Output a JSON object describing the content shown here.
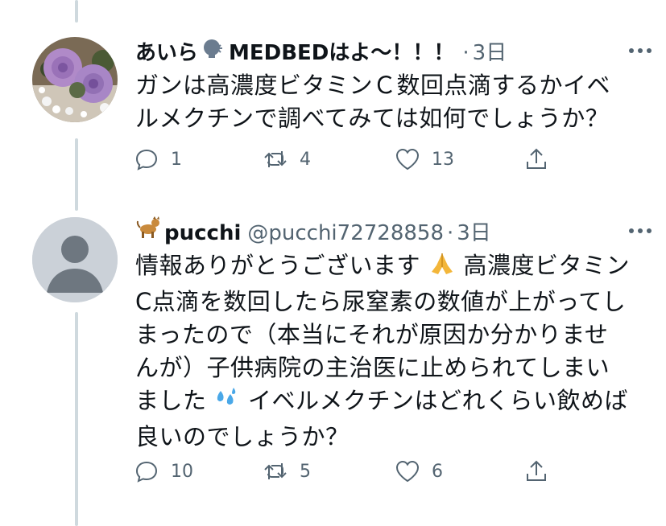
{
  "tweets": [
    {
      "name": "あいら",
      "name_suffix": "MEDBEDはよ〜！！！",
      "handle": "",
      "time": "3日",
      "text_lines": [
        "ガンは高濃度ビタミンＣ数回点滴するかイベ",
        "ルメクチンで調べてみては如何でしょうか？"
      ],
      "replies": "1",
      "retweets": "4",
      "likes": "13",
      "name_icon": "speaking-head-icon"
    },
    {
      "name": "pucchi",
      "handle": "@pucchi72728858",
      "time": "3日",
      "name_icon": "dog-icon",
      "text_segments": {
        "line1_a": "情報ありがとうございます",
        "line1_b": "高濃度ビタミン",
        "line2": "C点滴を数回したら尿窒素の数値が上がってし",
        "line3": "まったので（本当にそれが原因か分かりませ",
        "line4": "んが）子供病院の主治医に止められてしまい",
        "line5_a": "ました",
        "line5_b": "イベルメクチンはどれくらい飲めば",
        "line6": "良いのでしょうか？"
      },
      "replies": "10",
      "retweets": "5",
      "likes": "6"
    }
  ],
  "separator": "·",
  "colors": {
    "secondary": "#536471",
    "thread_line": "#cfd9de"
  }
}
